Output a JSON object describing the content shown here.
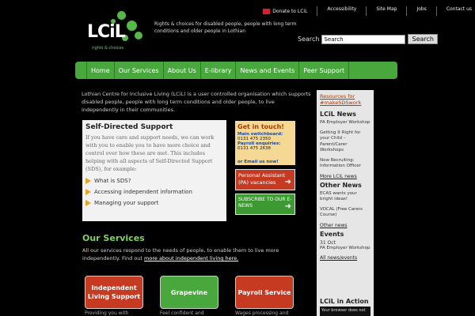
{
  "topbar": {
    "donate": "Donate to LCiL",
    "links": [
      "Accessibility",
      "Site Map",
      "Jobs",
      "Contact us"
    ]
  },
  "logo": {
    "word": "LCiL",
    "tagline": "rights & choices"
  },
  "strapline": "Rights & choices for disabled people, people with long term conditions and older people in Lothian",
  "search": {
    "label": "Search",
    "value": "Search",
    "button": "Search"
  },
  "nav": [
    "Home",
    "Our Services",
    "About Us",
    "E-library",
    "News and Events",
    "Peer Support"
  ],
  "intro": "Lothian Centre for Inclusive Living (LCiL) is a user controlled organisation which supports disabled people, people with long term conditions and older people, to live independently in their communities.",
  "sds": {
    "title": "Self-Directed Support",
    "body": "If you have care and support needs, we can work with you to enable you to have more choice and control over how these are met. This includes helping with all aspects of Self-Directed Support (SDS), for example:",
    "items": [
      "What is SDS?",
      "Accessing independent information",
      "Managing your support"
    ]
  },
  "contact": {
    "title": "Get in touch!",
    "main_label": "Main switchboard:",
    "main_number": "0131 475 2350",
    "payroll_label": "Payroll enquiries:",
    "payroll_number": "0131 475 2638",
    "email": "or Email us now!"
  },
  "pa_button": "Personal Assistant (PA) vacancies",
  "subscribe_button": "SUBSCRIBE TO OUR E-NEWS",
  "services": {
    "title": "Our Services",
    "text": "All our services respond to the needs of people, to enable them to live more independently. Find out ",
    "link": "more about independent living here.",
    "tiles": [
      {
        "label": "Independent Living Support",
        "color": "#c63a22",
        "sub": "Providing you with"
      },
      {
        "label": "Grapevine",
        "color": "#49a83d",
        "sub": "Feel confident and"
      },
      {
        "label": "Payroll Service",
        "color": "#c63a22",
        "sub": "Wages processing and"
      }
    ]
  },
  "right": {
    "resources": "Resources for #makeSDSwork",
    "lcil_news_title": "LCiL News",
    "lcil_news": [
      "PA Employer Workshop",
      "Getting It Right for your Child – Parent/Carer Workshops",
      "Now Recruiting: Information Officer"
    ],
    "lcil_news_more": "More LCiL news",
    "other_news_title": "Other News",
    "other_news": [
      "ECAS wants your bright ideas!",
      "VOCAL (Free Carers Course)"
    ],
    "other_news_more": "Other news",
    "events_title": "Events",
    "event_date": "31 Oct",
    "event_name": "PA Employer Workshop",
    "events_more": "All news/events",
    "action_title": "LCiL in Action",
    "video_text": "Your browser does not"
  },
  "colors": {
    "brand_green": "#49a83d",
    "accent_red": "#c63a22",
    "heading_green": "#7ed35a"
  }
}
